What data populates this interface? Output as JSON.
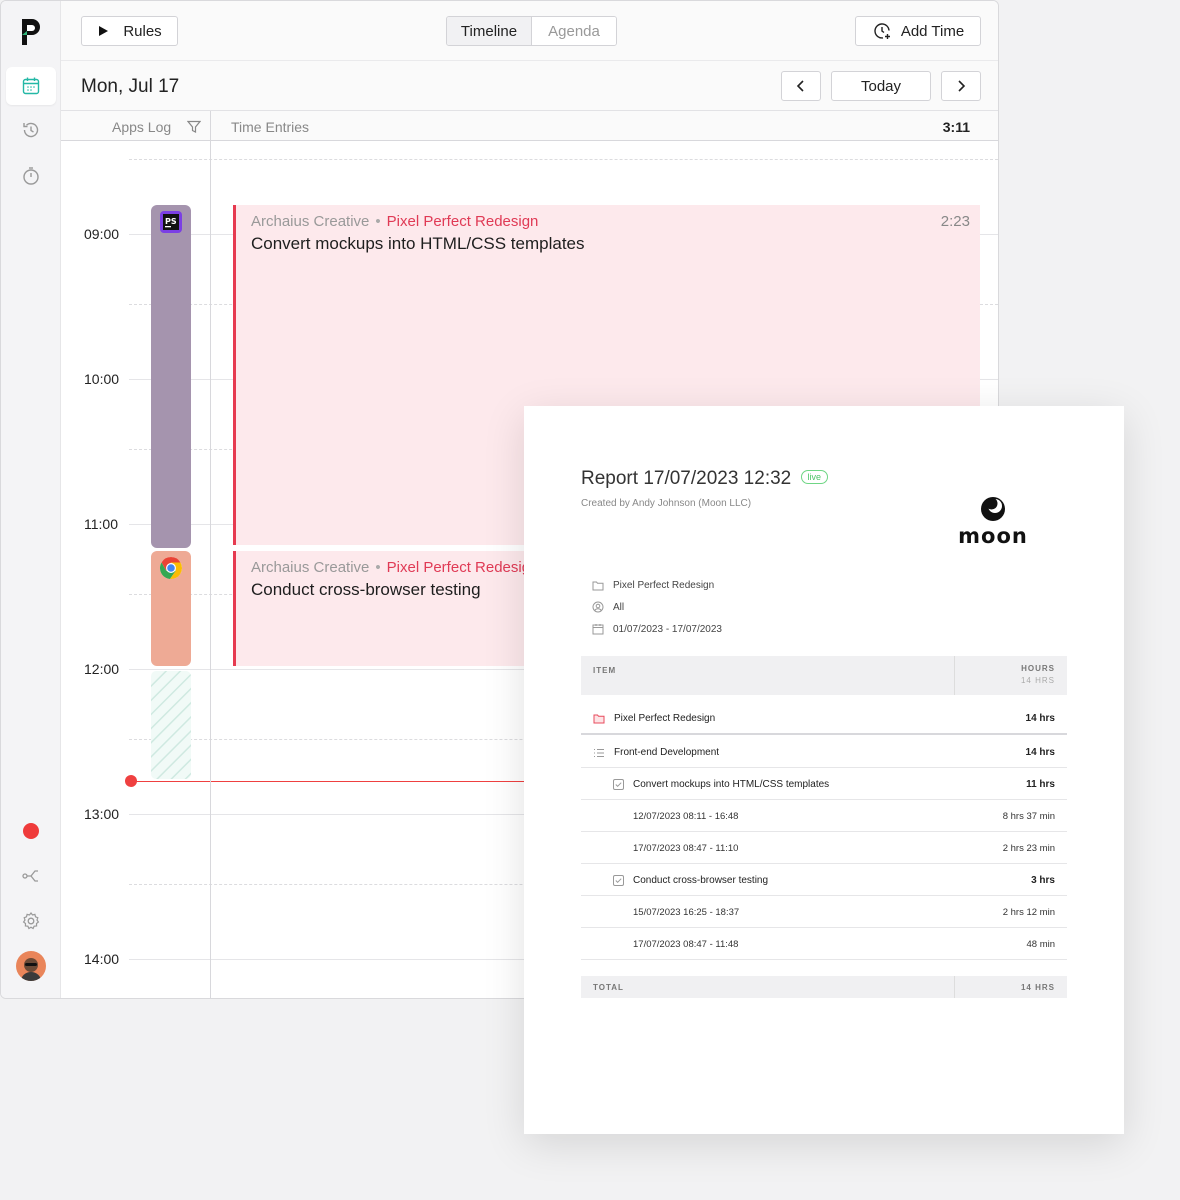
{
  "toolbar": {
    "rules_label": "Rules",
    "views": [
      "Timeline",
      "Agenda"
    ],
    "add_time_label": "Add Time"
  },
  "datebar": {
    "date": "Mon, Jul 17",
    "today_label": "Today"
  },
  "columns": {
    "apps_log": "Apps Log",
    "time_entries": "Time Entries",
    "total": "3:11"
  },
  "hours": [
    "09:00",
    "10:00",
    "11:00",
    "12:00",
    "13:00",
    "14:00"
  ],
  "entries": [
    {
      "client": "Archaius Creative",
      "project": "Pixel Perfect Redesign",
      "title": "Convert mockups into HTML/CSS templates",
      "duration": "2:23"
    },
    {
      "client": "Archaius Creative",
      "project": "Pixel Perfect Redesign",
      "title": "Conduct cross-browser testing",
      "duration": ""
    }
  ],
  "apps": [
    {
      "icon": "photoshop-icon",
      "color": "#a594ae"
    },
    {
      "icon": "chrome-icon",
      "color": "#eeaa95"
    }
  ],
  "colors": {
    "accent_red": "#e63a50",
    "entry_bg": "#fde9ec",
    "now_line": "#ef4040",
    "rail_accent": "#24b8a6"
  },
  "report": {
    "title": "Report",
    "datetime": "17/07/2023 12:32",
    "live_badge": "live",
    "created_by": "Created by Andy Johnson (Moon LLC)",
    "logo_text": "moon",
    "filters": {
      "project": "Pixel Perfect Redesign",
      "members": "All",
      "range": "01/07/2023 - 17/07/2023"
    },
    "table_head": {
      "item": "ITEM",
      "hours": "HOURS",
      "hours_sub": "14 HRS"
    },
    "rows": [
      {
        "label": "Pixel Perfect Redesign",
        "value": "14 hrs"
      },
      {
        "label": "Front-end Development",
        "value": "14 hrs"
      },
      {
        "label": "Convert mockups into HTML/CSS templates",
        "value": "11 hrs"
      },
      {
        "label": "12/07/2023  08:11 - 16:48",
        "value": "8 hrs 37 min"
      },
      {
        "label": "17/07/2023  08:47 - 11:10",
        "value": "2 hrs 23 min"
      },
      {
        "label": "Conduct cross-browser testing",
        "value": "3 hrs"
      },
      {
        "label": "15/07/2023  16:25 - 18:37",
        "value": "2 hrs 12 min"
      },
      {
        "label": "17/07/2023  08:47 - 11:48",
        "value": "48 min"
      }
    ],
    "total_label": "TOTAL",
    "total_value": "14 HRS"
  }
}
